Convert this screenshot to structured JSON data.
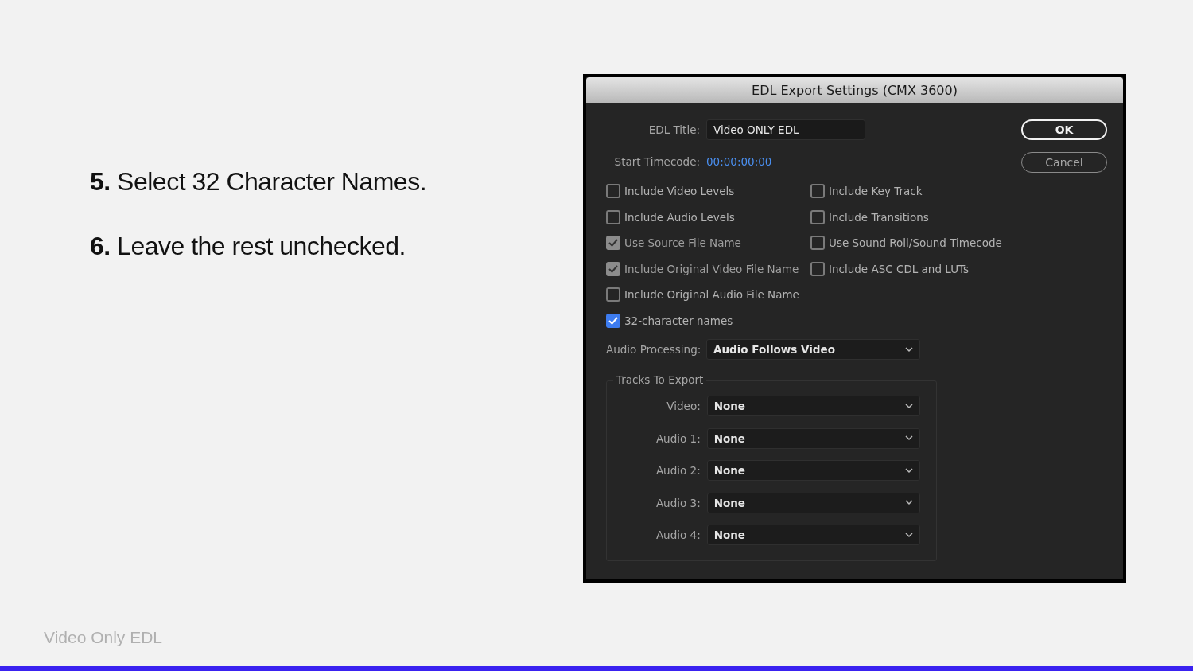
{
  "slide": {
    "steps": [
      "**5.** Select 32 Character Names.",
      "**6.** Leave the rest unchecked."
    ],
    "footer": "Video Only EDL"
  },
  "dialog": {
    "title": "EDL Export Settings (CMX 3600)",
    "edl_title": {
      "label": "EDL Title:",
      "value": "Video ONLY EDL"
    },
    "start_timecode": {
      "label": "Start Timecode:",
      "value": "00:00:00:00"
    },
    "buttons": [
      {
        "label": "OK",
        "default": true
      },
      {
        "label": "Cancel",
        "default": false
      }
    ],
    "options": [
      [
        {
          "label": "Include Video Levels",
          "checked": false,
          "disabled": false
        },
        {
          "label": "Include Audio Levels",
          "checked": false,
          "disabled": false
        },
        {
          "label": "Use Source File Name",
          "checked": true,
          "disabled": true
        },
        {
          "label": "Include Original Video File Name",
          "checked": true,
          "disabled": true
        },
        {
          "label": "Include Original Audio File Name",
          "checked": false,
          "disabled": false
        },
        {
          "label": "32-character names",
          "checked": true,
          "disabled": false
        }
      ],
      [
        {
          "label": "Include Key Track",
          "checked": false,
          "disabled": false
        },
        {
          "label": "Include Transitions",
          "checked": false,
          "disabled": false
        },
        {
          "label": "Use Sound Roll/Sound Timecode",
          "checked": false,
          "disabled": false
        },
        {
          "label": "Include ASC CDL and LUTs",
          "checked": false,
          "disabled": false
        }
      ]
    ],
    "audio_processing": {
      "label": "Audio Processing:",
      "value": "Audio Follows Video"
    },
    "tracks": {
      "title": "Tracks To Export",
      "rows": [
        {
          "label": "Video:",
          "value": "None"
        },
        {
          "label": "Audio 1:",
          "value": "None"
        },
        {
          "label": "Audio 2:",
          "value": "None"
        },
        {
          "label": "Audio 3:",
          "value": "None"
        },
        {
          "label": "Audio 4:",
          "value": "None"
        }
      ]
    }
  }
}
